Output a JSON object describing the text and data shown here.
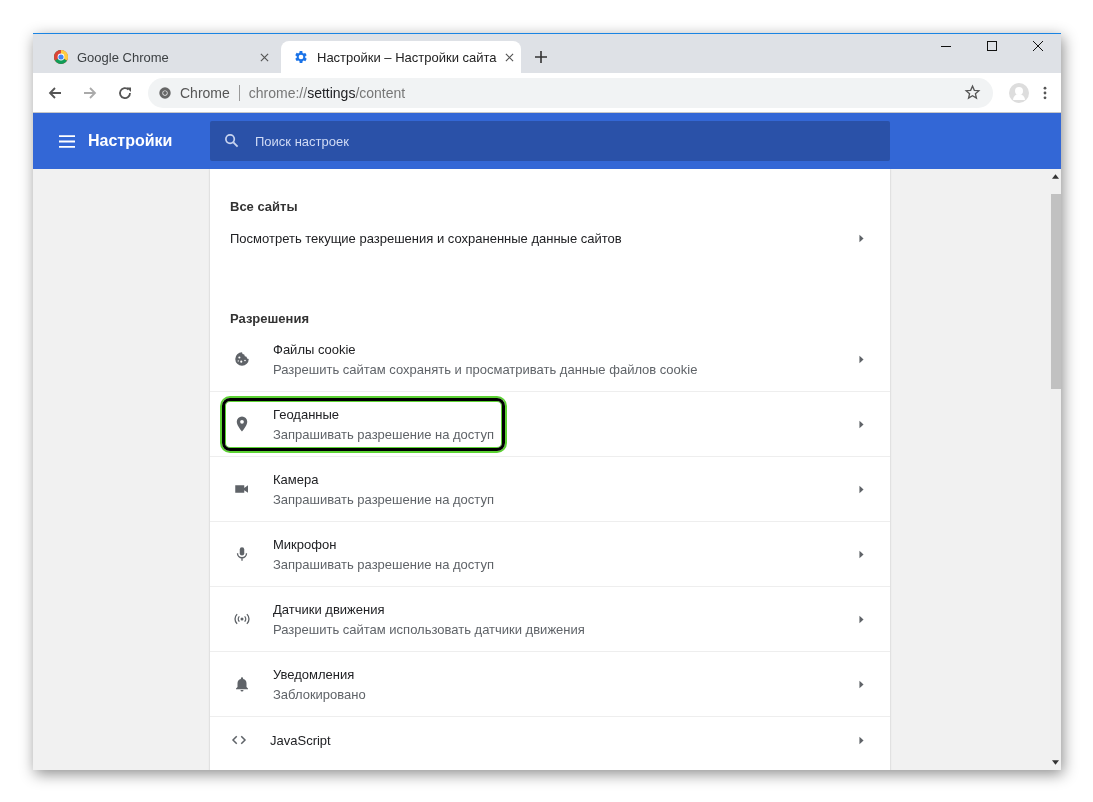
{
  "tabs": [
    {
      "title": "Google Chrome",
      "selected": false
    },
    {
      "title": "Настройки – Настройки сайта",
      "selected": true
    }
  ],
  "address": {
    "site": "Chrome",
    "url_prefix": "chrome://",
    "url_host": "settings",
    "url_path": "/content"
  },
  "header": {
    "title": "Настройки",
    "search_placeholder": "Поиск настроек"
  },
  "sections": [
    {
      "heading": "Все сайты",
      "rows": [
        {
          "title": "Посмотреть текущие разрешения и сохраненные данные сайтов",
          "highlighted": false
        }
      ]
    },
    {
      "heading": "Разрешения",
      "rows": [
        {
          "title": "Файлы cookie",
          "subtitle": "Разрешить сайтам сохранять и просматривать данные файлов cookie",
          "highlighted": false
        },
        {
          "title": "Геоданные",
          "subtitle": "Запрашивать разрешение на доступ",
          "highlighted": true
        },
        {
          "title": "Камера",
          "subtitle": "Запрашивать разрешение на доступ",
          "highlighted": false
        },
        {
          "title": "Микрофон",
          "subtitle": "Запрашивать разрешение на доступ",
          "highlighted": false
        },
        {
          "title": "Датчики движения",
          "subtitle": "Разрешить сайтам использовать датчики движения",
          "highlighted": false
        },
        {
          "title": "Уведомления",
          "subtitle": "Заблокировано",
          "highlighted": false
        },
        {
          "title": "JavaScript",
          "highlighted": false
        }
      ]
    }
  ]
}
